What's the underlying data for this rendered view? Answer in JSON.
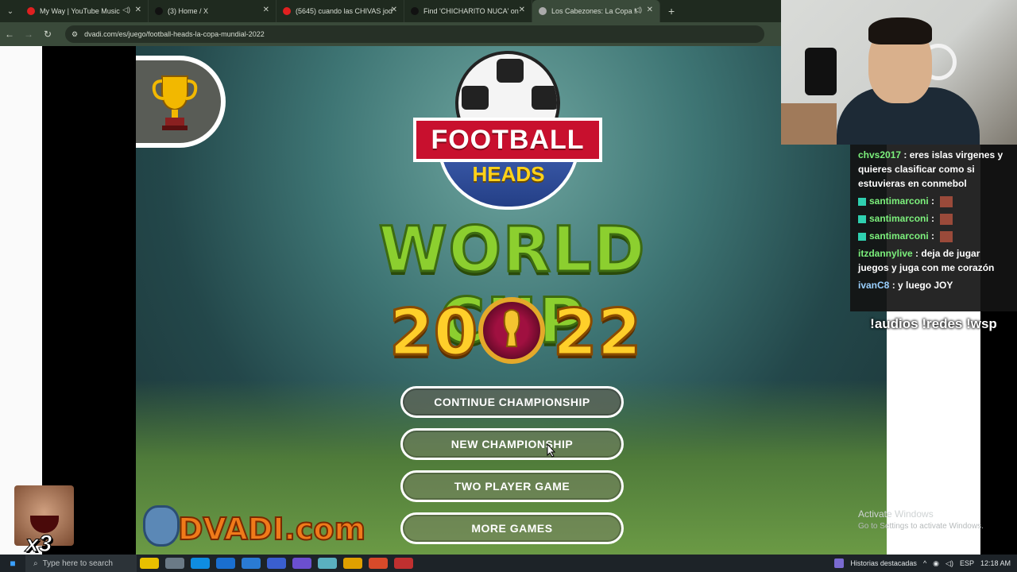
{
  "browser": {
    "tabs": [
      {
        "label": "My Way | YouTube Music",
        "favicon_color": "#e02020",
        "has_sound": true
      },
      {
        "label": "(3) Home / X",
        "favicon_color": "#111111",
        "has_sound": false
      },
      {
        "label": "(5645) cuando las CHIVAS jodi",
        "favicon_color": "#e02020",
        "has_sound": false
      },
      {
        "label": "Find 'CHICHARITO NUCA' on Ti",
        "favicon_color": "#111111",
        "has_sound": false
      },
      {
        "label": "Los Cabezones: La Copa M",
        "favicon_color": "#aaaaaa",
        "has_sound": true,
        "active": true
      }
    ],
    "url": "dvadi.com/es/juego/football-heads-la-copa-mundial-2022"
  },
  "game": {
    "logo_top": "FOOTBALL",
    "logo_bottom": "HEADS",
    "title": "WORLD CUP",
    "year_left": "20",
    "year_right": "22",
    "menu": [
      "CONTINUE CHAMPIONSHIP",
      "NEW CHAMPIONSHIP",
      "TWO PLAYER GAME",
      "MORE GAMES"
    ],
    "brand": "DVADI.com"
  },
  "chat": {
    "messages": [
      {
        "user": "chvs2017",
        "text": "eres islas virgenes y quieres clasificar como si estuvieras en conmebol",
        "badge": false,
        "emote": false
      },
      {
        "user": "santimarconi",
        "text": "",
        "badge": true,
        "emote": true
      },
      {
        "user": "santimarconi",
        "text": "",
        "badge": true,
        "emote": true
      },
      {
        "user": "santimarconi",
        "text": "",
        "badge": true,
        "emote": true
      },
      {
        "user": "itzdannylive",
        "text": "deja de jugar juegos y juga con me corazón",
        "badge": false,
        "emote": false
      },
      {
        "user": "ivanC8",
        "text": "y luego JOY",
        "badge": false,
        "emote": false,
        "alt_color": true
      }
    ],
    "commands": "!audios !redes !wsp"
  },
  "overlay": {
    "emote_multiplier": "x3"
  },
  "windows": {
    "activate_title": "Activate Windows",
    "activate_sub": "Go to Settings to activate Windows.",
    "search_placeholder": "Type here to search",
    "news_label": "Historias destacadas",
    "language": "ESP",
    "time": "12:18 AM"
  }
}
